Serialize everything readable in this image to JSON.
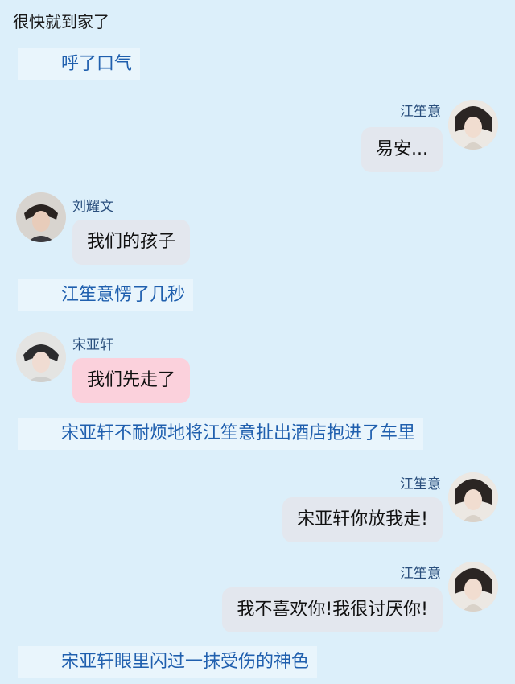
{
  "top_line": "很快就到家了",
  "messages": [
    {
      "type": "narration",
      "text": "呼了口气"
    },
    {
      "type": "right",
      "name": "江笙意",
      "text": "易安..."
    },
    {
      "type": "left",
      "name": "刘耀文",
      "text": "我们的孩子"
    },
    {
      "type": "narration",
      "text": "江笙意愣了几秒"
    },
    {
      "type": "left",
      "name": "宋亚轩",
      "text": "我们先走了"
    },
    {
      "type": "narration",
      "text": "宋亚轩不耐烦地将江笙意扯出酒店抱进了车里"
    },
    {
      "type": "right",
      "name": "江笙意",
      "text": "宋亚轩你放我走!"
    },
    {
      "type": "right",
      "name": "江笙意",
      "text": "我不喜欢你!我很讨厌你!"
    },
    {
      "type": "narration",
      "text": "宋亚轩眼里闪过一抹受伤的神色"
    }
  ],
  "colors": {
    "background": "#dceffa",
    "narration_bg": "#e9f5fc",
    "narration_text": "#1f5fae",
    "bubble_gray": "#e3e7ee",
    "bubble_pink": "#fbd1dc"
  },
  "icons": {
    "jiang": "avatar-jiangshengyi",
    "liu": "avatar-liuyaowen",
    "song": "avatar-songyaxuan"
  }
}
